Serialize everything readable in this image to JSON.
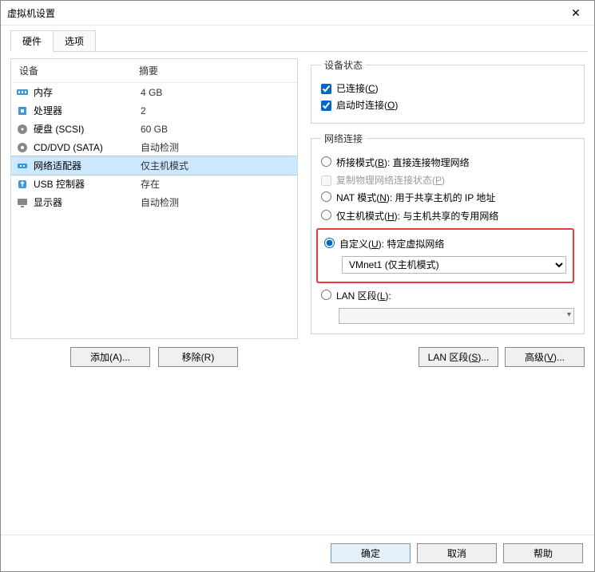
{
  "window": {
    "title": "虚拟机设置"
  },
  "tabs": {
    "hardware": "硬件",
    "options": "选项"
  },
  "hwTable": {
    "colDevice": "设备",
    "colSummary": "摘要",
    "rows": [
      {
        "name": "内存",
        "summary": "4 GB"
      },
      {
        "name": "处理器",
        "summary": "2"
      },
      {
        "name": "硬盘 (SCSI)",
        "summary": "60 GB"
      },
      {
        "name": "CD/DVD (SATA)",
        "summary": "自动检测"
      },
      {
        "name": "网络适配器",
        "summary": "仅主机模式"
      },
      {
        "name": "USB 控制器",
        "summary": "存在"
      },
      {
        "name": "显示器",
        "summary": "自动检测"
      }
    ],
    "selectedIndex": 4
  },
  "leftButtons": {
    "add": "添加(A)...",
    "remove": "移除(R)"
  },
  "deviceStatus": {
    "legend": "设备状态",
    "connected": "已连接(C)",
    "connectAtPower": "启动时连接(O)"
  },
  "netConn": {
    "legend": "网络连接",
    "bridged": "桥接模式(B): 直接连接物理网络",
    "bridgedRepl": "复制物理网络连接状态(P)",
    "nat": "NAT 模式(N): 用于共享主机的 IP 地址",
    "hostOnly": "仅主机模式(H): 与主机共享的专用网络",
    "custom": "自定义(U): 特定虚拟网络",
    "customValue": "VMnet1 (仅主机模式)",
    "lanSeg": "LAN 区段(L):",
    "lanSegValue": ""
  },
  "rightButtons": {
    "lanSeg": "LAN 区段(S)...",
    "advanced": "高级(V)..."
  },
  "footer": {
    "ok": "确定",
    "cancel": "取消",
    "help": "帮助"
  }
}
